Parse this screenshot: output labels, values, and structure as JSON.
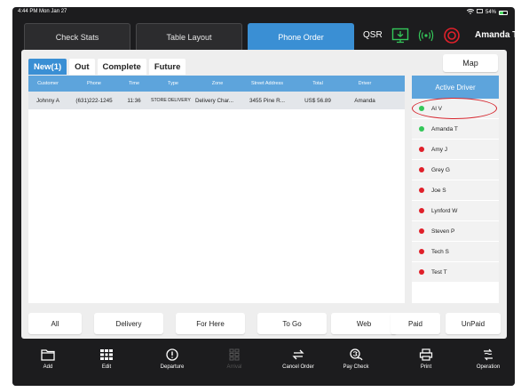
{
  "status": {
    "time": "4:44 PM  Mon Jan 27",
    "battery": "54%"
  },
  "header": {
    "tabs": [
      {
        "label": "Check Stats",
        "active": false
      },
      {
        "label": "Table Layout",
        "active": false
      },
      {
        "label": "Phone Order",
        "active": true
      }
    ],
    "qsr_label": "QSR",
    "user_name": "Amanda T"
  },
  "order_tabs": [
    {
      "label": "New(1)",
      "active": true
    },
    {
      "label": "Out",
      "active": false
    },
    {
      "label": "Complete",
      "active": false
    },
    {
      "label": "Future",
      "active": false
    }
  ],
  "map_label": "Map",
  "table": {
    "columns": [
      "Customer",
      "Phone",
      "Time",
      "Type",
      "Zone",
      "Street Address",
      "Total",
      "Driver"
    ],
    "rows": [
      {
        "customer": "Johnny A",
        "phone": "(631)222-1245",
        "time": "11:36",
        "type": "STORE DELIVERY",
        "zone": "Delivery Char...",
        "address": "3455  Pine R...",
        "total": "US$ 56.89",
        "driver": "Amanda"
      }
    ]
  },
  "drivers": {
    "title": "Active Driver",
    "list": [
      {
        "name": "Al V",
        "status": "active"
      },
      {
        "name": "Amanda T",
        "status": "active"
      },
      {
        "name": "Amy J",
        "status": "inactive"
      },
      {
        "name": "Grey G",
        "status": "inactive"
      },
      {
        "name": "Joe S",
        "status": "inactive"
      },
      {
        "name": "Lynford W",
        "status": "inactive"
      },
      {
        "name": "Steven P",
        "status": "inactive"
      },
      {
        "name": "Tech S",
        "status": "inactive"
      },
      {
        "name": "Test T",
        "status": "inactive"
      }
    ]
  },
  "filters": [
    "All",
    "Delivery",
    "For Here",
    "To Go",
    "Web",
    "Paid",
    "UnPaid"
  ],
  "toolbar": [
    {
      "label": "Add",
      "icon": "folder-icon",
      "enabled": true
    },
    {
      "label": "Edit",
      "icon": "grid-icon",
      "enabled": true
    },
    {
      "label": "Departure",
      "icon": "alert-circle-icon",
      "enabled": true
    },
    {
      "label": "Arrival",
      "icon": "arrival-grid-icon",
      "enabled": false
    },
    {
      "label": "Cancel Order",
      "icon": "swap-arrows-icon",
      "enabled": true
    },
    {
      "label": "Pay Check",
      "icon": "pay-check-icon",
      "enabled": true
    },
    {
      "label": "Print",
      "icon": "printer-icon",
      "enabled": true
    },
    {
      "label": "Operation",
      "icon": "operation-icon",
      "enabled": true
    }
  ],
  "colors": {
    "accent": "#3a8fd4",
    "table_header": "#5da4dc",
    "active_dot": "#34c759",
    "inactive_dot": "#e0202a",
    "highlight": "#d6262e"
  }
}
